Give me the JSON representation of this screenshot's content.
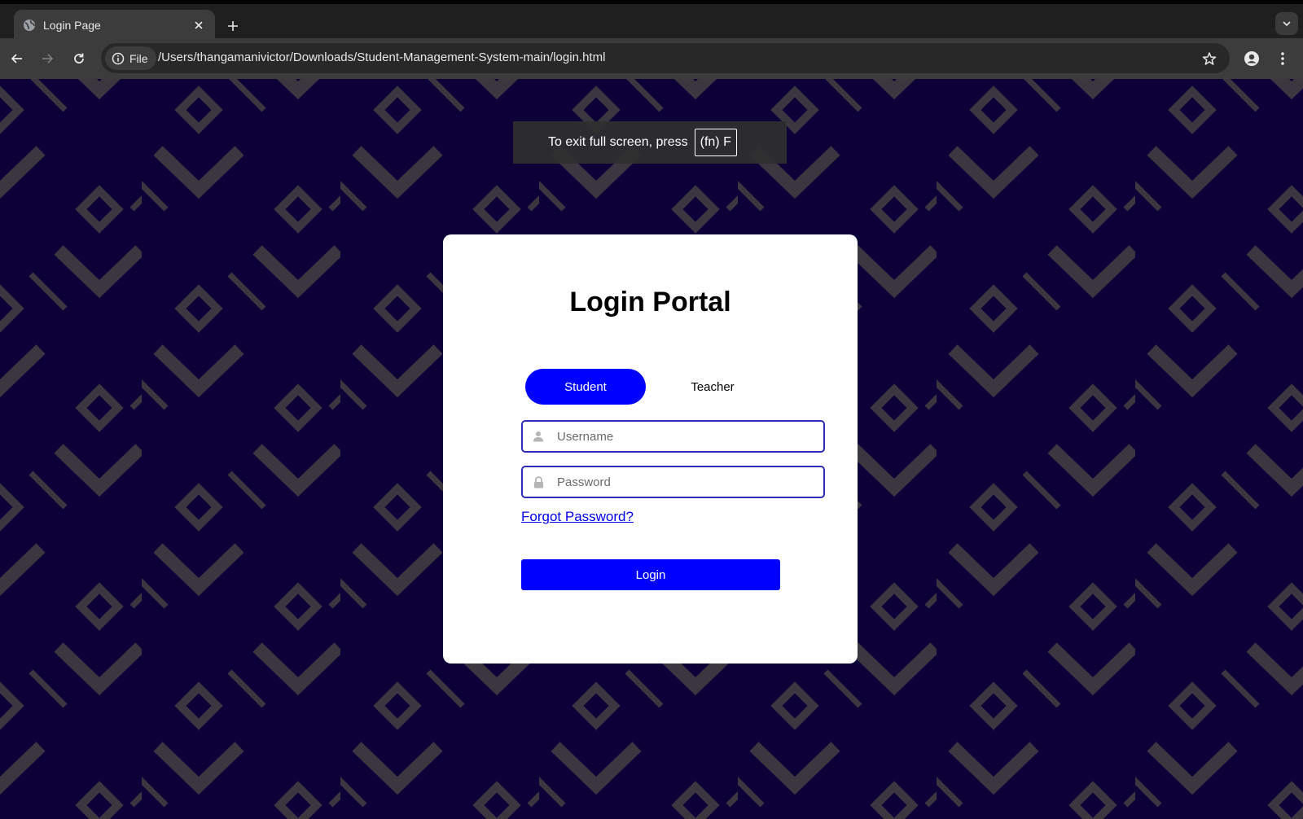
{
  "browser": {
    "tab": {
      "title": "Login Page"
    },
    "toolbar": {
      "chip_label": "File",
      "url": "/Users/thangamanivictor/Downloads/Student-Management-System-main/login.html"
    },
    "fullscreen_notice": {
      "text": "To exit full screen, press",
      "key": "(fn) F"
    }
  },
  "page": {
    "title": "Login Portal",
    "roles": {
      "student": "Student",
      "teacher": "Teacher",
      "selected": "Student"
    },
    "username": {
      "placeholder": "Username",
      "value": ""
    },
    "password": {
      "placeholder": "Password",
      "value": ""
    },
    "forgot_link": "Forgot Password?",
    "login_button": "Login"
  },
  "colors": {
    "page_background": "#0b0138",
    "pattern": "#3a3740",
    "accent": "#0000ff",
    "field_border": "#2c2cb8",
    "link": "#0000ee"
  }
}
